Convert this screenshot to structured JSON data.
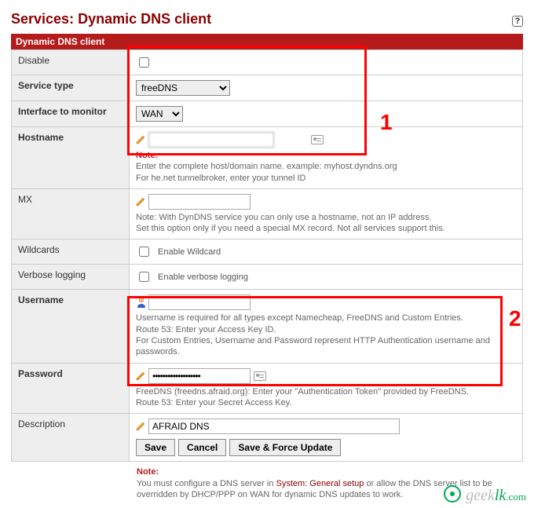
{
  "header": {
    "title_prefix": "Services:",
    "title_main": "Dynamic DNS client"
  },
  "section_bar": "Dynamic DNS client",
  "rows": {
    "disable": {
      "label": "Disable"
    },
    "service_type": {
      "label": "Service type",
      "value": "freeDNS"
    },
    "interface": {
      "label": "Interface to monitor",
      "value": "WAN"
    },
    "hostname": {
      "label": "Hostname",
      "value": "",
      "note_label": "Note:",
      "note1": "Enter the complete host/domain name. example: myhost.dyndns.org",
      "note2": "For he.net tunnelbroker, enter your tunnel ID"
    },
    "mx": {
      "label": "MX",
      "value": "",
      "note1": "Note: With DynDNS service you can only use a hostname, not an IP address.",
      "note2": "Set this option only if you need a special MX record. Not all services support this."
    },
    "wildcards": {
      "label": "Wildcards",
      "checkbox_label": "Enable Wildcard"
    },
    "verbose": {
      "label": "Verbose logging",
      "checkbox_label": "Enable verbose logging"
    },
    "username": {
      "label": "Username",
      "value": "",
      "note1": "Username is required for all types except Namecheap, FreeDNS and Custom Entries.",
      "note2": "Route 53: Enter your Access Key ID.",
      "note3": "For Custom Entries, Username and Password represent HTTP Authentication username and passwords."
    },
    "password": {
      "label": "Password",
      "value": "•••••••••••••••••••",
      "note1": "FreeDNS (freedns.afraid.org): Enter your \"Authentication Token\" provided by FreeDNS.",
      "note2": "Route 53: Enter your Secret Access Key."
    },
    "description": {
      "label": "Description",
      "value": "AFRAID DNS"
    }
  },
  "buttons": {
    "save": "Save",
    "cancel": "Cancel",
    "save_force": "Save & Force Update"
  },
  "footnote": {
    "note_label": "Note:",
    "part1": "You must configure a DNS server in ",
    "link": "System: General setup",
    "part2": " or allow the DNS server list to be overridden by DHCP/PPP on WAN for dynamic DNS updates to work."
  },
  "annotations": {
    "one": "1",
    "two": "2"
  },
  "watermark1": "geek",
  "watermark2": "lk",
  "watermark3": ".com"
}
